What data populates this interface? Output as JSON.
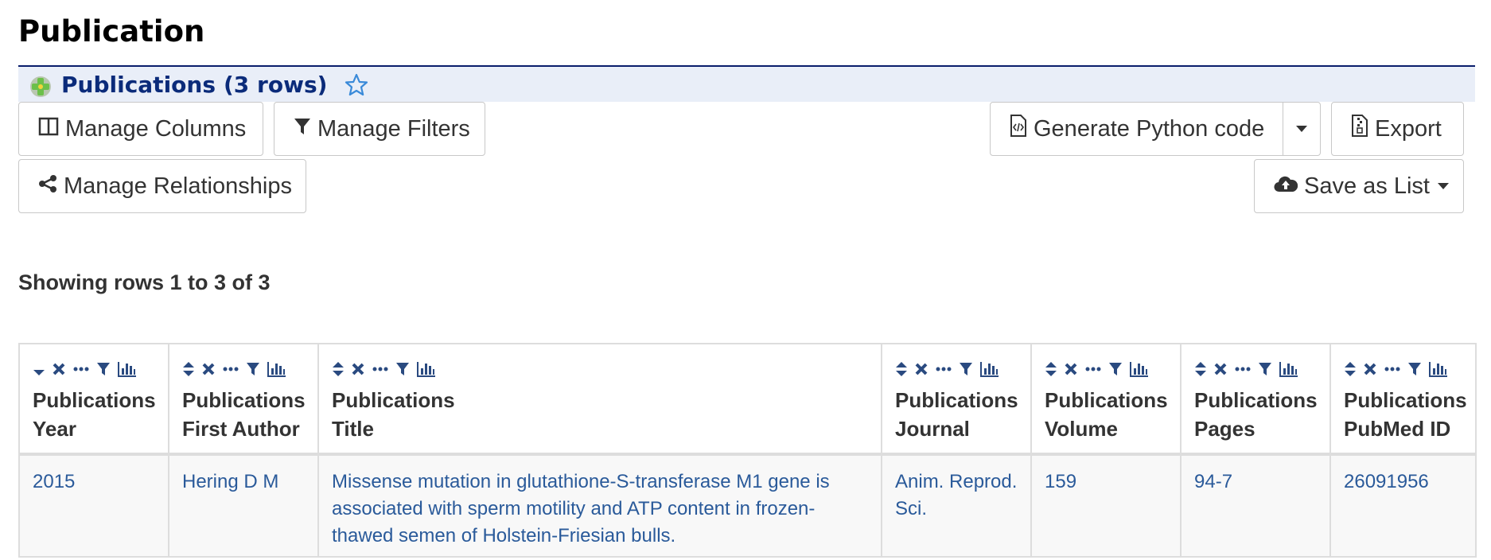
{
  "page": {
    "title": "Publication"
  },
  "header": {
    "title": "Publications",
    "rows": "(3 rows)"
  },
  "toolbar": {
    "manage_columns": "Manage Columns",
    "manage_filters": "Manage Filters",
    "manage_relationships": "Manage Relationships",
    "generate_code": "Generate Python code",
    "export": "Export",
    "save_as_list": "Save as List"
  },
  "status": {
    "showing": "Showing rows 1 to 3 of 3"
  },
  "table": {
    "columns": [
      {
        "line1": "Publications",
        "line2": "Year"
      },
      {
        "line1": "Publications",
        "line2": "First Author"
      },
      {
        "line1": "Publications",
        "line2": "Title"
      },
      {
        "line1": "Publications",
        "line2": "Journal"
      },
      {
        "line1": "Publications",
        "line2": "Volume"
      },
      {
        "line1": "Publications",
        "line2": "Pages"
      },
      {
        "line1": "Publications",
        "line2": "PubMed ID"
      }
    ],
    "rows": [
      {
        "year": "2015",
        "first_author": "Hering D M",
        "title": "Missense mutation in glutathione-S-transferase M1 gene is associated with sperm motility and ATP content in frozen-thawed semen of Holstein-Friesian bulls.",
        "journal": "Anim. Reprod. Sci.",
        "volume": "159",
        "pages": "94-7",
        "pubmed_id": "26091956"
      }
    ]
  },
  "colors": {
    "accent": "#0b2b7a",
    "link": "#2a5a9a",
    "header_bg": "#e9eef8",
    "icon": "#2a4a80"
  }
}
